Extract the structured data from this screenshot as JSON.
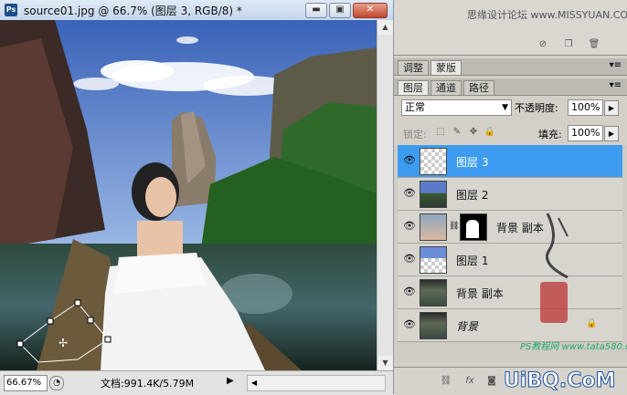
{
  "document": {
    "title": "source01.jpg @ 66.7% (图层 3, RGB/8) *",
    "zoom": "66.67%",
    "info": "文档:991.4K/5.79M",
    "window_buttons": [
      "minimize",
      "restore",
      "close"
    ]
  },
  "watermark_top": "思缘设计论坛 www.MISSYUAN.COM",
  "panel_tabs_top": [
    "调整",
    "蒙版"
  ],
  "layers_panel": {
    "tabs": [
      "图层",
      "通道",
      "路径"
    ],
    "blend_mode": "正常",
    "opacity_label": "不透明度:",
    "opacity_value": "100%",
    "lock_label": "锁定:",
    "fill_label": "填充:",
    "fill_value": "100%",
    "layers": [
      {
        "name": "图层 3",
        "selected": true,
        "thumb": "transparent-figure"
      },
      {
        "name": "图层 2",
        "selected": false,
        "thumb": "scene"
      },
      {
        "name": "背景 副本",
        "selected": false,
        "thumb": "portrait",
        "mask": true
      },
      {
        "name": "图层 1",
        "selected": false,
        "thumb": "sky"
      },
      {
        "name": "背景 副本",
        "selected": false,
        "thumb": "scene"
      },
      {
        "name": "背景",
        "selected": false,
        "thumb": "scene",
        "locked": true
      }
    ]
  },
  "watermark_bottom": "PS教程网 www.tata580.com",
  "watermark_logo": "UiBQ.CoM",
  "colors": {
    "selected_layer": "#3d9cf0",
    "sky": "#4f74c4",
    "water": "#1f3b3a"
  }
}
